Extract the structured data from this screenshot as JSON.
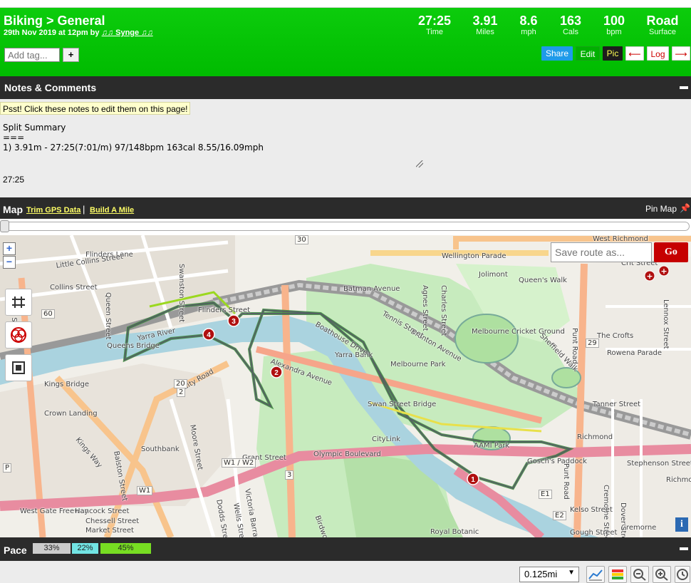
{
  "header": {
    "title": "Biking > General",
    "date": "29th Nov 2019 at 12pm by",
    "user": "♫♫ Synge ♫♫",
    "stats": [
      {
        "value": "27:25",
        "label": "Time"
      },
      {
        "value": "3.91",
        "label": "Miles"
      },
      {
        "value": "8.6",
        "label": "mph"
      },
      {
        "value": "163",
        "label": "Cals"
      },
      {
        "value": "100",
        "label": "bpm"
      },
      {
        "value": "Road",
        "label": "Surface"
      }
    ],
    "tag_placeholder": "Add tag...",
    "tag_add_label": "+",
    "buttons": {
      "share": "Share",
      "edit": "Edit",
      "pic": "Pic",
      "prev": "⟵",
      "log": "Log",
      "next": "⟶"
    }
  },
  "notes": {
    "heading": "Notes & Comments",
    "hint": "Psst! Click these notes to edit them on this page!",
    "text": "Split Summary\n===\n1) 3.91m - 27:25(7:01/m) 97/148bpm 163cal 8.55/16.09mph",
    "time": "27:25"
  },
  "map_bar": {
    "heading": "Map",
    "trim_link": "Trim GPS Data",
    "separator": "|",
    "build_link": "Build A Mile",
    "pin_label": "Pin Map",
    "pin_icon": "📌"
  },
  "map": {
    "zoom_in": "+",
    "zoom_out": "−",
    "save_placeholder": "Save route as...",
    "go_label": "Go",
    "info_label": "i",
    "labels": [
      {
        "text": "Flinders Lane"
      },
      {
        "text": "Collins Street"
      },
      {
        "text": "Little Collins Street"
      },
      {
        "text": "Wellington Parade"
      },
      {
        "text": "Jolimont"
      },
      {
        "text": "Queen's Walk"
      },
      {
        "text": "West Richmond"
      },
      {
        "text": "Crit Street"
      },
      {
        "text": "King Street"
      },
      {
        "text": "Queen Street"
      },
      {
        "text": "Swanston Street"
      },
      {
        "text": "Flinders Street"
      },
      {
        "text": "Yarra River"
      },
      {
        "text": "Queens Bridge"
      },
      {
        "text": "Kings Bridge"
      },
      {
        "text": "City Road"
      },
      {
        "text": "Alexandra Avenue"
      },
      {
        "text": "Melbourne Park"
      },
      {
        "text": "Melbourne Cricket Ground"
      },
      {
        "text": "Brunton Avenue"
      },
      {
        "text": "Punt Road"
      },
      {
        "text": "The Crofts"
      },
      {
        "text": "Rowena Parade"
      },
      {
        "text": "Tanner Street"
      },
      {
        "text": "Richmond"
      },
      {
        "text": "Crown Landing"
      },
      {
        "text": "Southbank"
      },
      {
        "text": "Kings Way"
      },
      {
        "text": "West Gate Freeway"
      },
      {
        "text": "CityLink"
      },
      {
        "text": "Swan Street Bridge"
      },
      {
        "text": "AAMI Park"
      },
      {
        "text": "Gosch's Paddock"
      },
      {
        "text": "Victoria Barracks"
      },
      {
        "text": "Royal Botanic"
      },
      {
        "text": "Cremorne"
      },
      {
        "text": "Hancock Street"
      },
      {
        "text": "Chessell Street"
      },
      {
        "text": "Market Street"
      },
      {
        "text": "Dodds Street"
      },
      {
        "text": "Grant Street"
      },
      {
        "text": "Wells Street"
      },
      {
        "text": "Moore Street"
      },
      {
        "text": "Balston Street"
      },
      {
        "text": "Birdwood Avenue"
      },
      {
        "text": "Olympic Boulevard"
      },
      {
        "text": "Yarra Bank"
      },
      {
        "text": "Boathouse Drive"
      },
      {
        "text": "Cremorne Street"
      },
      {
        "text": "Punt Road"
      },
      {
        "text": "Kelso Street"
      },
      {
        "text": "Dover Street"
      },
      {
        "text": "Gough Street"
      },
      {
        "text": "Sheffield Walk"
      },
      {
        "text": "Lennox Street"
      },
      {
        "text": "Stephenson Street"
      },
      {
        "text": "Richmond"
      },
      {
        "text": "Batman Avenue"
      },
      {
        "text": "Tennis Street"
      },
      {
        "text": "Charles Street"
      },
      {
        "text": "Agnes Street"
      }
    ],
    "road_numbers": [
      "30",
      "60",
      "20",
      "2",
      "29",
      "3",
      "W1 / W2",
      "W1",
      "E1",
      "E2",
      "P"
    ],
    "markers": [
      {
        "label": "1"
      },
      {
        "label": "2"
      },
      {
        "label": "3"
      },
      {
        "label": "4"
      }
    ]
  },
  "pace": {
    "heading": "Pace",
    "segments": [
      {
        "label": "33%",
        "color": "#cccccc"
      },
      {
        "label": "22%",
        "color": "#72e4e4"
      },
      {
        "label": "45%",
        "color": "#77dd22"
      }
    ]
  },
  "bottom": {
    "distance": "0.125mi",
    "tools": [
      "chart-icon",
      "color-bands-icon",
      "zoom-out-icon",
      "zoom-in-icon",
      "clock-icon"
    ]
  },
  "colors": {
    "header_green": "#00c000",
    "bar_dark": "#2b2b2b",
    "go_red": "#c60000",
    "share_blue": "#1e9be9"
  }
}
